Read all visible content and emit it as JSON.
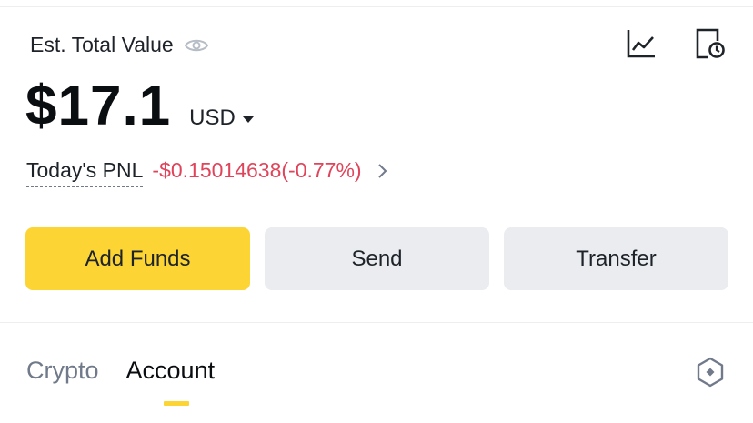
{
  "header": {
    "est_label": "Est. Total Value",
    "icons": [
      "eye-icon",
      "chart-icon",
      "history-icon"
    ]
  },
  "balance": {
    "amount": "$17.1",
    "currency": "USD"
  },
  "pnl": {
    "label": "Today's PNL",
    "value": "-$0.15014638(-0.77%)",
    "color": "#e0445a"
  },
  "actions": {
    "add_funds": "Add Funds",
    "send": "Send",
    "transfer": "Transfer",
    "primary_color": "#fcd535",
    "secondary_color": "#eaecef"
  },
  "tabs": [
    {
      "label": "Crypto",
      "active": false
    },
    {
      "label": "Account",
      "active": true
    }
  ]
}
